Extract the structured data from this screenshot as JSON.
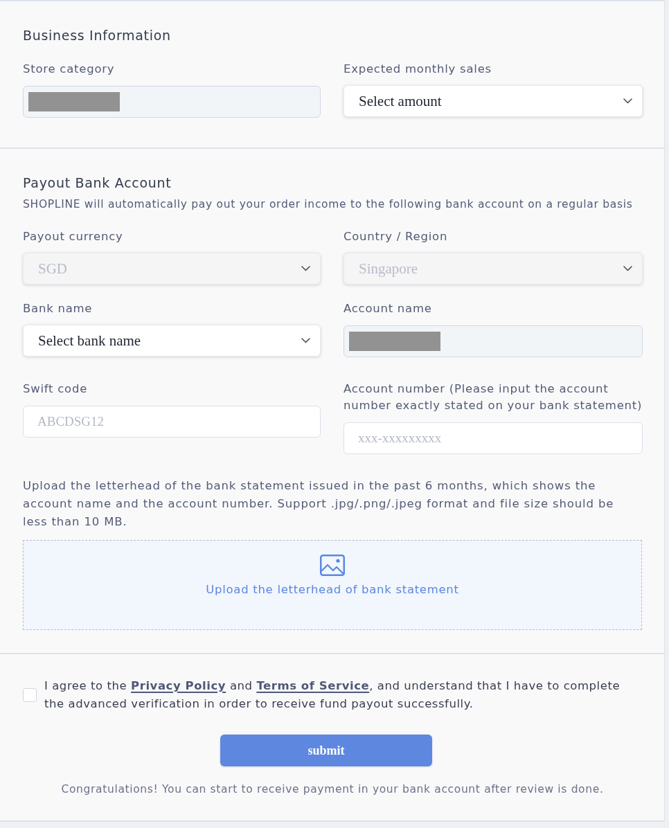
{
  "sections": [
    {
      "title": "Business Information",
      "fields": [
        {
          "kind": "input",
          "label": "Store category",
          "disabled": true,
          "redacted": true
        },
        {
          "kind": "select",
          "label": "Expected monthly sales",
          "value": "Select amount",
          "disabled": false
        }
      ]
    },
    {
      "title": "Payout Bank Account",
      "description": "SHOPLINE will automatically pay out your order income to the following bank account on a regular basis",
      "fields": [
        {
          "kind": "select",
          "label": "Payout currency",
          "value": "SGD",
          "disabled": true
        },
        {
          "kind": "select",
          "label": "Country / Region",
          "value": "Singapore",
          "disabled": true
        },
        {
          "kind": "select",
          "label": "Bank name",
          "value": "Select bank name",
          "disabled": false
        },
        {
          "kind": "input",
          "label": "Account name",
          "disabled": true,
          "redacted": true
        },
        {
          "kind": "input",
          "label": "Swift code",
          "placeholder": "ABCDSG12",
          "disabled": false,
          "redacted": false
        },
        {
          "kind": "input",
          "label": "Account number (Please input the account number exactly stated on your bank statement)",
          "placeholder": "xxx-xxxxxxxxx",
          "disabled": false,
          "redacted": false
        }
      ],
      "upload": {
        "instructions": "Upload the letterhead of the bank statement issued in the past 6 months, which shows the account name and the account number. Support .jpg/.png/.jpeg format and file size should be less than 10 MB.",
        "label": "Upload the letterhead of bank statement"
      }
    }
  ],
  "agreement": {
    "checked": false,
    "parts": [
      {
        "kind": "text",
        "text": "I agree to the "
      },
      {
        "kind": "link",
        "text": "Privacy Policy"
      },
      {
        "kind": "text",
        "text": " and "
      },
      {
        "kind": "link",
        "text": "Terms of Service"
      },
      {
        "kind": "text",
        "text": ", and understand that I have to complete the advanced verification in order to receive fund payout successfully."
      }
    ]
  },
  "submit": {
    "label": "submit"
  },
  "note": "Congratulations! You can start to receive payment in your bank account after review is done."
}
